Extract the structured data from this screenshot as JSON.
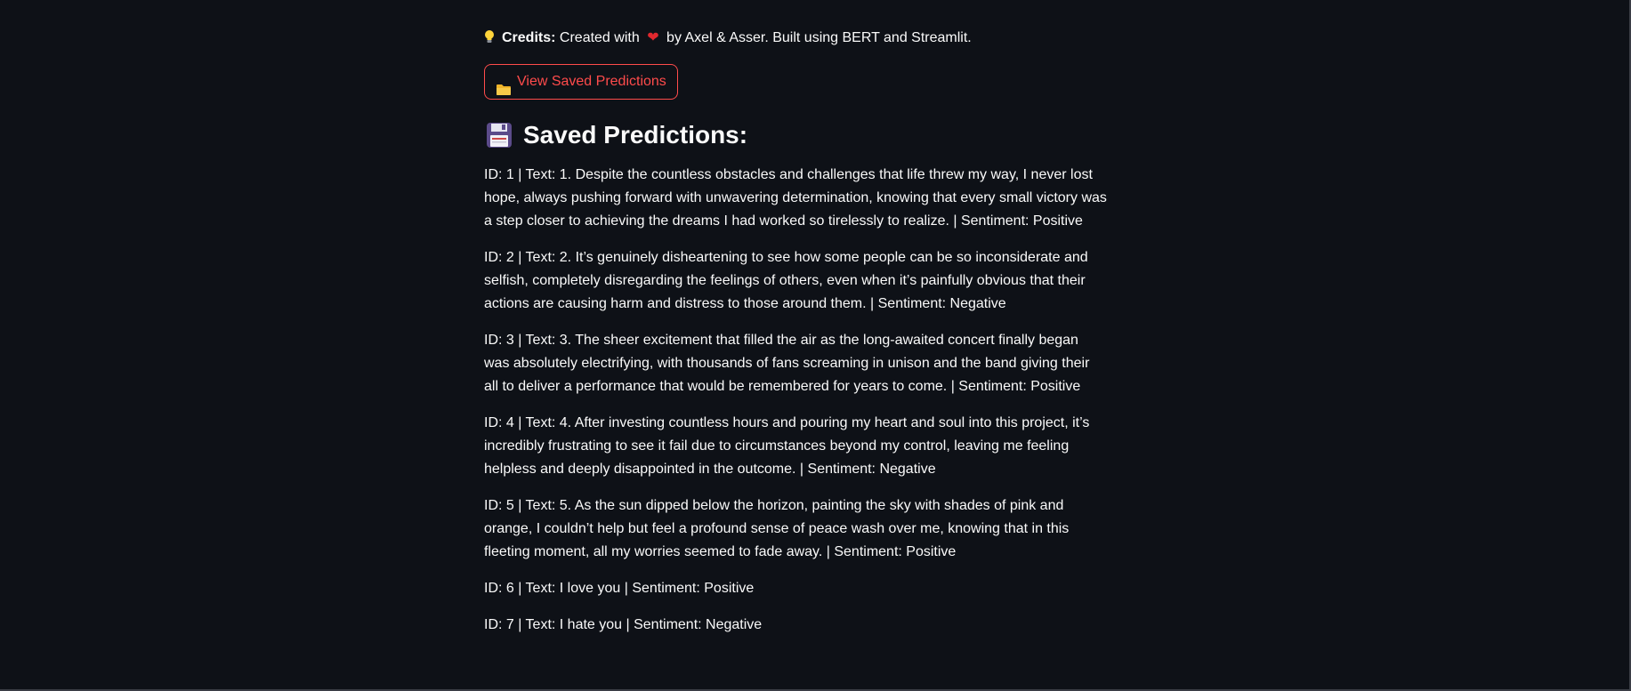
{
  "credits": {
    "icon": "lightbulb-icon",
    "label": "Credits:",
    "text_before": "Created with",
    "heart_icon": "heart-icon",
    "heart": "❤",
    "text_after": "by Axel & Asser. Built using BERT and Streamlit."
  },
  "button": {
    "icon": "folder-icon",
    "label": "View Saved Predictions",
    "color": "#ff4b4b"
  },
  "section": {
    "icon": "floppy-disk-icon",
    "title": "Saved Predictions:"
  },
  "predictions": [
    {
      "text": "ID: 1 | Text: 1. Despite the countless obstacles and challenges that life threw my way, I never lost hope, always pushing forward with unwavering determination, knowing that every small victory was a step closer to achieving the dreams I had worked so tirelessly to realize. | Sentiment: Positive"
    },
    {
      "text": "ID: 2 | Text: 2. It’s genuinely disheartening to see how some people can be so inconsiderate and selfish, completely disregarding the feelings of others, even when it’s painfully obvious that their actions are causing harm and distress to those around them. | Sentiment: Negative"
    },
    {
      "text": "ID: 3 | Text: 3. The sheer excitement that filled the air as the long-awaited concert finally began was absolutely electrifying, with thousands of fans screaming in unison and the band giving their all to deliver a performance that would be remembered for years to come. | Sentiment: Positive"
    },
    {
      "text": "ID: 4 | Text: 4. After investing countless hours and pouring my heart and soul into this project, it’s incredibly frustrating to see it fail due to circumstances beyond my control, leaving me feeling helpless and deeply disappointed in the outcome. | Sentiment: Negative"
    },
    {
      "text": "ID: 5 | Text: 5. As the sun dipped below the horizon, painting the sky with shades of pink and orange, I couldn’t help but feel a profound sense of peace wash over me, knowing that in this fleeting moment, all my worries seemed to fade away. | Sentiment: Positive"
    },
    {
      "text": "ID: 6 | Text: I love you | Sentiment: Positive"
    },
    {
      "text": "ID: 7 | Text: I hate you | Sentiment: Negative"
    }
  ],
  "colors": {
    "background": "#0e1117",
    "text": "#fafafa",
    "accent": "#ff4b4b"
  }
}
